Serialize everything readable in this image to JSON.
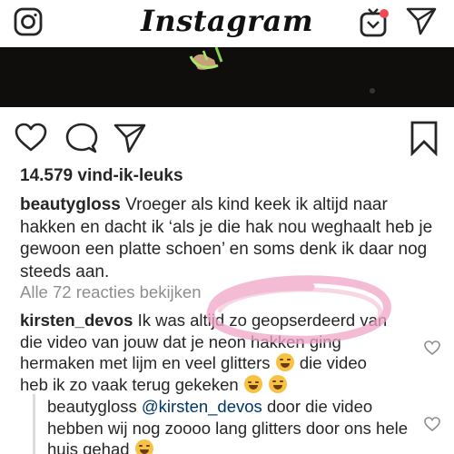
{
  "header": {
    "logo_text": "Instagram",
    "icons": [
      "camera-icon",
      "igtv-icon",
      "direct-send-icon"
    ],
    "notification_dot_color": "#ed4956"
  },
  "post": {
    "likes_text": "14.579 vind-ik-leuks",
    "caption": {
      "username": "beautygloss",
      "text": "Vroeger als kind keek ik altijd naar hakken en dacht ik ‘als je die hak nou weghaalt heb je gewoon een platte schoen’ en soms denk ik daar nog steeds aan."
    },
    "view_all_comments": "Alle 72 reacties bekijken",
    "comments": [
      {
        "username": "kirsten_devos",
        "text_part1": "Ik was altijd zo geopserdeerd van die video van jouw dat je neon hakken ging hermaken met lijm en veel glitters",
        "text_part2": "die video heb ik zo vaak terug gekeken"
      }
    ],
    "reply": {
      "username": "beautygloss",
      "mention": "@kirsten_devos",
      "text": "door die video hebben wij nog zoooo lang glitters door ons hele huis gehad"
    }
  },
  "colors": {
    "text": "#262626",
    "muted": "#8e8e8e",
    "mention": "#003569",
    "highlight": "#f0a6c6"
  }
}
